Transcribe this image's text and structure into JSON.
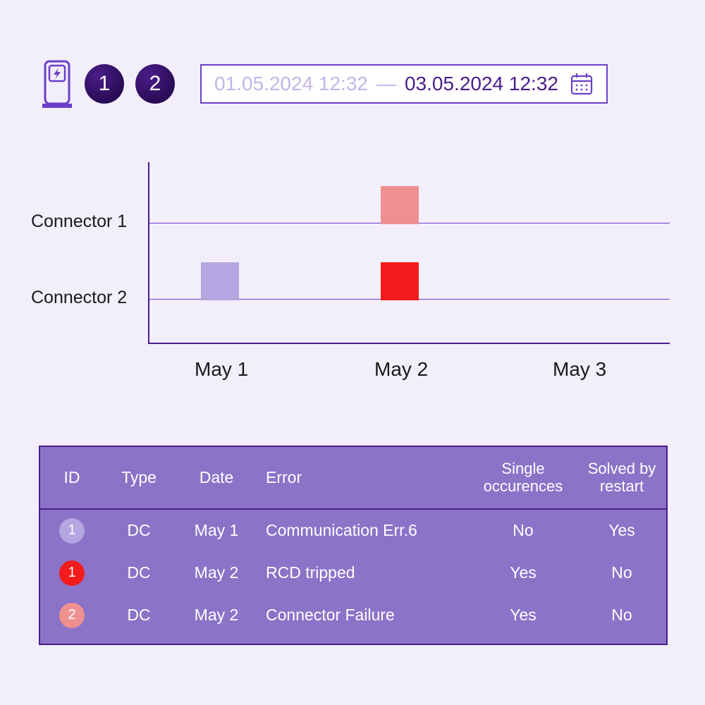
{
  "header": {
    "connector_badges": [
      "1",
      "2"
    ],
    "date_from": "01.05.2024 12:32",
    "date_dash": "—",
    "date_to": "03.05.2024 12:32"
  },
  "chart_data": {
    "type": "scatter",
    "title": "",
    "xlabel": "",
    "ylabel": "",
    "categories": [
      "May 1",
      "May 2",
      "May 3"
    ],
    "rows": [
      "Connector 1",
      "Connector 2"
    ],
    "markers": [
      {
        "row": "Connector 1",
        "x": "May 2",
        "color": "#ee9090"
      },
      {
        "row": "Connector 2",
        "x": "May 1",
        "color": "#b3a6e1"
      },
      {
        "row": "Connector 2",
        "x": "May 2",
        "color": "#f31b1b"
      }
    ]
  },
  "table": {
    "headers": {
      "id": "ID",
      "type": "Type",
      "date": "Date",
      "error": "Error",
      "single": "Single occurences",
      "solved": "Solved by restart"
    },
    "rows": [
      {
        "id": "1",
        "id_color": "#b3a6e1",
        "type": "DC",
        "date": "May 1",
        "error": "Communication Err.6",
        "single": "No",
        "solved": "Yes"
      },
      {
        "id": "1",
        "id_color": "#f31b1b",
        "type": "DC",
        "date": "May 2",
        "error": "RCD tripped",
        "single": "Yes",
        "solved": "No"
      },
      {
        "id": "2",
        "id_color": "#ee9090",
        "type": "DC",
        "date": "May 2",
        "error": "Connector Failure",
        "single": "Yes",
        "solved": "No"
      }
    ]
  },
  "colors": {
    "purple": "#4a1d8a",
    "purple_light": "#8b73c8"
  }
}
